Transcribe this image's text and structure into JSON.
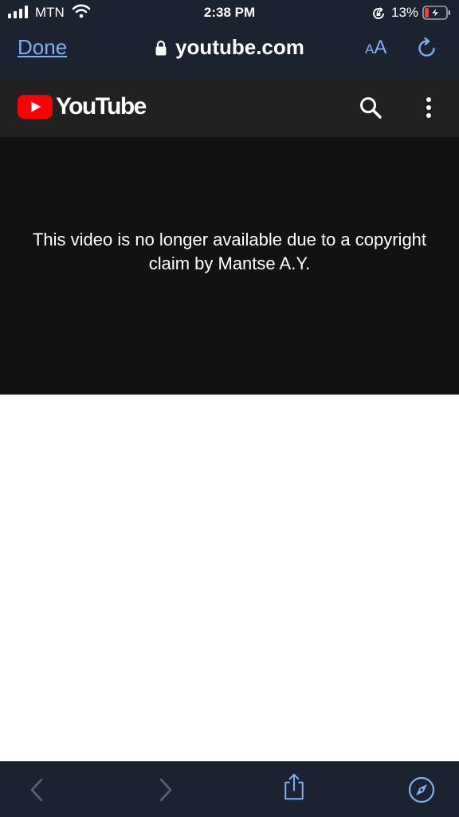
{
  "status_bar": {
    "carrier": "MTN",
    "time": "2:38 PM",
    "battery_percent": "13%",
    "icons": [
      "signal-icon",
      "wifi-icon",
      "rotation-lock-icon",
      "battery-charging-icon"
    ]
  },
  "browser": {
    "done_label": "Done",
    "url": "youtube.com",
    "text_size_small": "A",
    "text_size_large": "A",
    "accent_color": "#7fb0f5",
    "icons": [
      "lock-icon",
      "reload-icon"
    ]
  },
  "youtube": {
    "wordmark": "YouTube",
    "brand_color": "#ff0000",
    "icons": [
      "youtube-play-icon",
      "search-icon",
      "more-vert-icon"
    ]
  },
  "player": {
    "message": "This video is no longer available due to a copyright claim by Mantse A.Y."
  },
  "toolbar": {
    "icons": [
      "back-icon",
      "forward-icon",
      "share-icon",
      "compass-icon"
    ]
  }
}
